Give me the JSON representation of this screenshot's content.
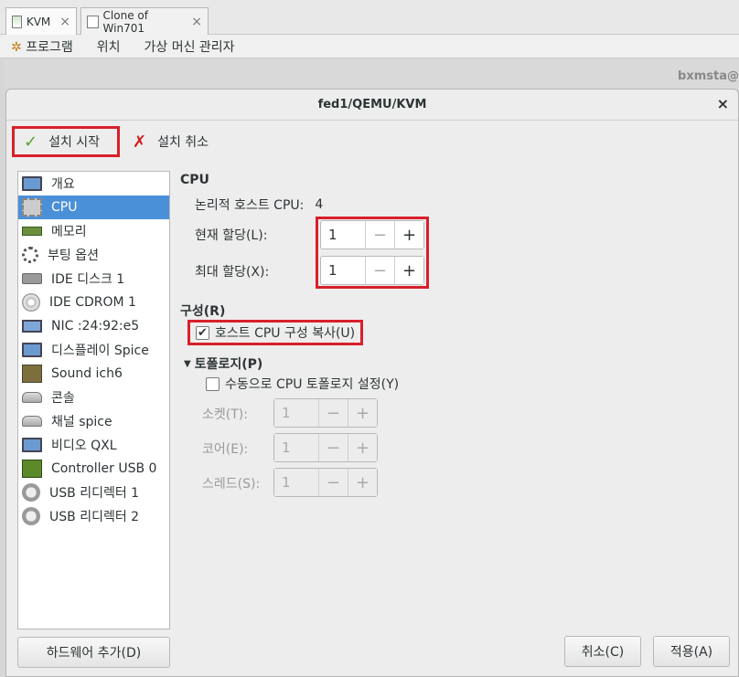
{
  "tabs": [
    {
      "label": "KVM",
      "close": "×"
    },
    {
      "label": "Clone of Win701",
      "close": "×"
    }
  ],
  "menu": [
    "프로그램",
    "위치",
    "가상 머신 관리자"
  ],
  "behind": {
    "user": "bxmsta@"
  },
  "dialog": {
    "title": "fed1/QEMU/KVM",
    "close": "×"
  },
  "toolbar": {
    "begin_label": "설치 시작",
    "cancel_label": "설치 취소"
  },
  "sidebar": {
    "items": [
      {
        "label": "개요",
        "icon": "monitor-icon"
      },
      {
        "label": "CPU",
        "icon": "cpu-chip-icon",
        "selected": true
      },
      {
        "label": "메모리",
        "icon": "memory-icon"
      },
      {
        "label": "부팅 옵션",
        "icon": "gear-icon"
      },
      {
        "label": "IDE 디스크 1",
        "icon": "disk-icon"
      },
      {
        "label": "IDE CDROM 1",
        "icon": "cdrom-icon"
      },
      {
        "label": "NIC :24:92:e5",
        "icon": "network-icon"
      },
      {
        "label": "디스플레이 Spice",
        "icon": "display-icon"
      },
      {
        "label": "Sound ich6",
        "icon": "sound-icon"
      },
      {
        "label": "콘솔",
        "icon": "console-icon"
      },
      {
        "label": "채널 spice",
        "icon": "channel-icon"
      },
      {
        "label": "비디오 QXL",
        "icon": "video-icon"
      },
      {
        "label": "Controller USB 0",
        "icon": "controller-icon"
      },
      {
        "label": "USB 리디렉터 1",
        "icon": "usb-icon"
      },
      {
        "label": "USB 리디렉터 2",
        "icon": "usb-icon"
      }
    ],
    "add_hardware": "하드웨어 추가(D)"
  },
  "cpu": {
    "heading": "CPU",
    "logical_label": "논리적 호스트 CPU:",
    "logical_value": "4",
    "current_label": "현재 할당(L):",
    "current_value": "1",
    "max_label": "최대 할당(X):",
    "max_value": "1",
    "minus": "−",
    "plus": "+"
  },
  "config": {
    "heading": "구성(R)",
    "copy_host_label": "호스트 CPU 구성 복사(U)",
    "copy_host_checked": true
  },
  "topology": {
    "heading": "토폴로지(P)",
    "manual_label": "수동으로 CPU 토폴로지 설정(Y)",
    "sockets_label": "소켓(T):",
    "sockets_value": "1",
    "cores_label": "코어(E):",
    "cores_value": "1",
    "threads_label": "스레드(S):",
    "threads_value": "1"
  },
  "buttons": {
    "cancel": "취소(C)",
    "apply": "적용(A)"
  },
  "colors": {
    "highlight": "#d8202a",
    "selection": "#4a90d9"
  }
}
